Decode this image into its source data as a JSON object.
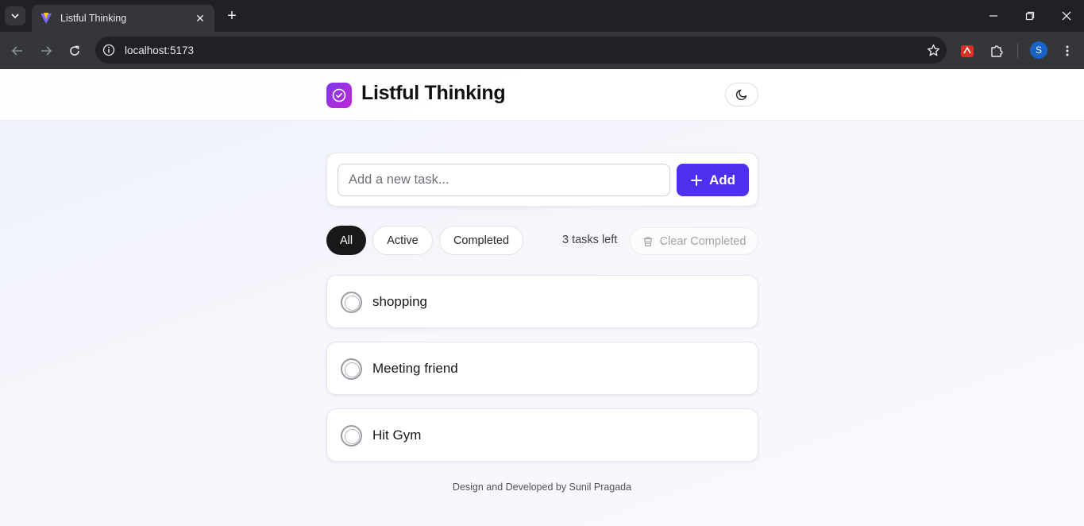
{
  "browser": {
    "tab_title": "Listful Thinking",
    "tab_close": "✕",
    "new_tab": "+",
    "url": "localhost:5173",
    "profile_initial": "S"
  },
  "app": {
    "brand": "Listful Thinking",
    "accent_color": "#4f2ff0",
    "logo_gradient": [
      "#7c3aed",
      "#c026d3"
    ]
  },
  "add_task": {
    "placeholder": "Add a new task...",
    "value": "",
    "button_label": "Add"
  },
  "filters": {
    "all": "All",
    "active": "Active",
    "completed": "Completed",
    "selected": "All"
  },
  "tasks_left": "3 tasks left",
  "clear_completed": "Clear Completed",
  "tasks": [
    {
      "text": "shopping",
      "done": false
    },
    {
      "text": "Meeting friend",
      "done": false
    },
    {
      "text": "Hit Gym",
      "done": false
    }
  ],
  "footer": "Design and Developed by Sunil Pragada"
}
